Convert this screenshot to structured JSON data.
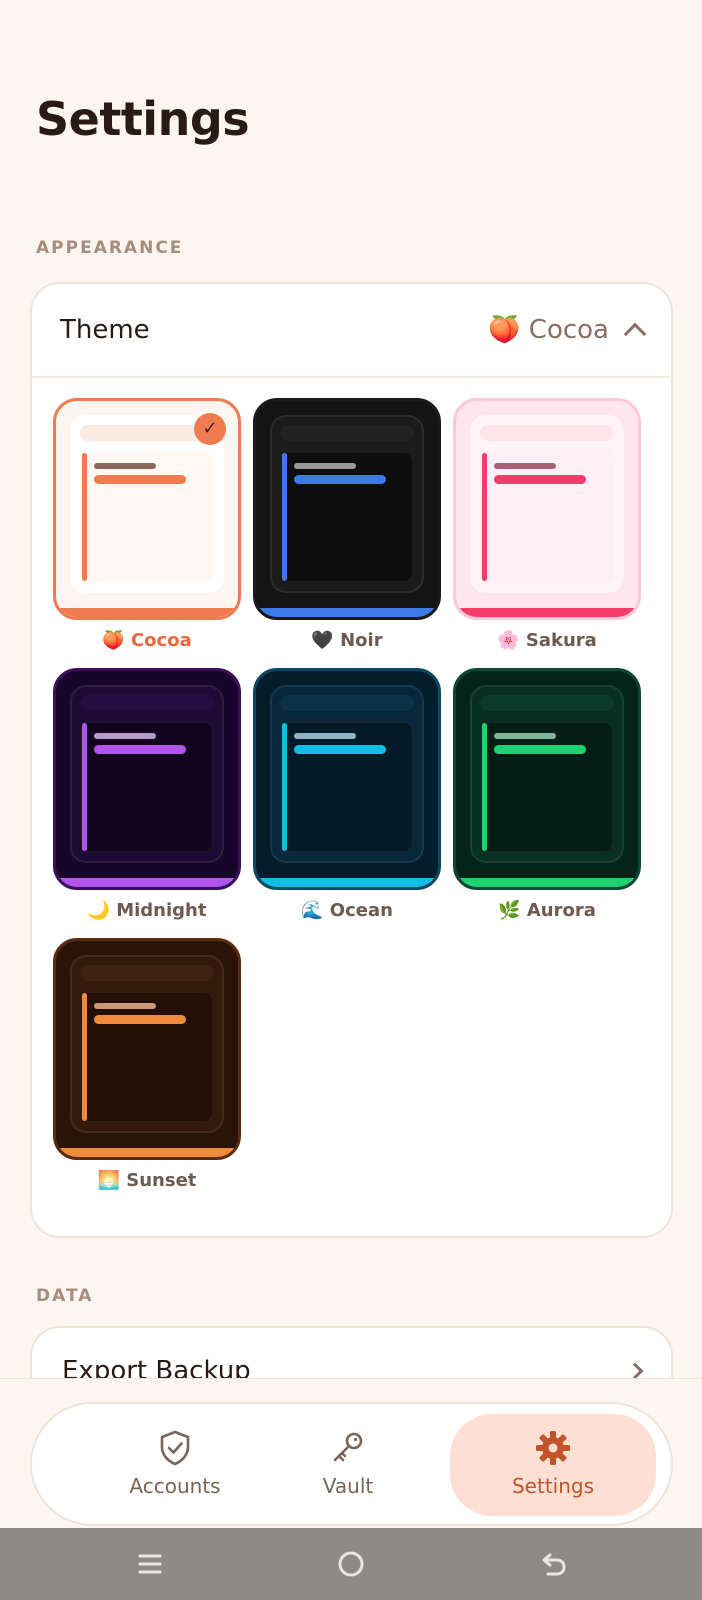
{
  "page": {
    "title": "Settings"
  },
  "appearance": {
    "section_label": "APPEARANCE",
    "theme_label": "Theme",
    "current_theme_emoji": "🍑",
    "current_theme": "Cocoa"
  },
  "themes": [
    {
      "emoji": "🍑",
      "name": "Cocoa",
      "selected": true,
      "bg": "#fdf6f0",
      "frame": "#ffffff",
      "panel": "#fff8f3",
      "topbar": "#fbeae1",
      "accent": "#ef7b50",
      "line1": "#8b6a5e",
      "border": "#ef7b50"
    },
    {
      "emoji": "🖤",
      "name": "Noir",
      "selected": false,
      "bg": "#141414",
      "frame": "#1b1b1b",
      "panel": "#0d0d0d",
      "topbar": "#222222",
      "accent": "#3b7ae8",
      "line1": "#9a9a9a",
      "border": "#1a1a1a"
    },
    {
      "emoji": "🌸",
      "name": "Sakura",
      "selected": false,
      "bg": "#ffe6ee",
      "frame": "#fff4f7",
      "panel": "#fff0f5",
      "topbar": "#ffe4ec",
      "accent": "#f23d6a",
      "line1": "#a7627a",
      "border": "#ffc8d6"
    },
    {
      "emoji": "🌙",
      "name": "Midnight",
      "selected": false,
      "bg": "#18062a",
      "frame": "#1e0a34",
      "panel": "#12041f",
      "topbar": "#260c40",
      "accent": "#b055ea",
      "line1": "#b59cc8",
      "border": "#3a0f5e"
    },
    {
      "emoji": "🌊",
      "name": "Ocean",
      "selected": false,
      "bg": "#031d2b",
      "frame": "#06283a",
      "panel": "#041a27",
      "topbar": "#0a3147",
      "accent": "#13bde3",
      "line1": "#8bb4c4",
      "border": "#0a4963"
    },
    {
      "emoji": "🌿",
      "name": "Aurora",
      "selected": false,
      "bg": "#04241a",
      "frame": "#072f22",
      "panel": "#041e15",
      "topbar": "#0b3a2a",
      "accent": "#1fd170",
      "line1": "#7fb59c",
      "border": "#0b4a32"
    },
    {
      "emoji": "🌅",
      "name": "Sunset",
      "selected": false,
      "bg": "#2a1408",
      "frame": "#331a0b",
      "panel": "#230f05",
      "topbar": "#3e2110",
      "accent": "#f08a3c",
      "line1": "#c8987a",
      "border": "#5a2b0d"
    }
  ],
  "data": {
    "section_label": "DATA",
    "export_label": "Export Backup"
  },
  "nav": {
    "accounts": "Accounts",
    "vault": "Vault",
    "settings": "Settings"
  },
  "colors": {
    "accent": "#ef7b50",
    "background": "#fdf6f0",
    "nav_active_bg": "#fde0d3"
  }
}
